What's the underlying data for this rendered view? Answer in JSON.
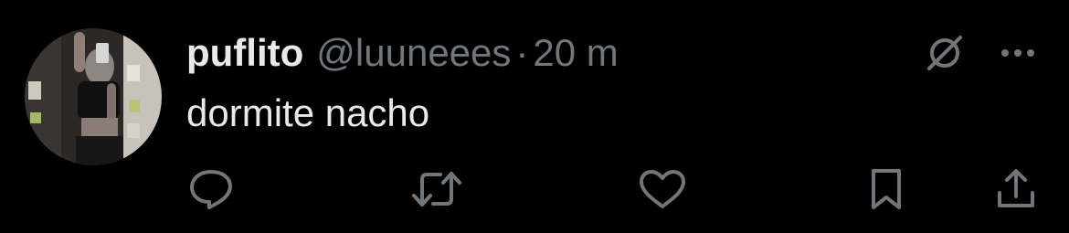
{
  "tweet": {
    "display_name": "puflito",
    "handle": "@luuneees",
    "separator": "·",
    "time": "20 m",
    "text": "dormite nacho"
  },
  "icons": {
    "top_right": [
      "grok-icon",
      "more-icon"
    ],
    "actions": [
      "reply-icon",
      "retweet-icon",
      "like-icon",
      "bookmark-icon",
      "share-icon"
    ]
  },
  "colors": {
    "background": "#000000",
    "primary_text": "#e7e9ea",
    "secondary_text": "#71767b"
  }
}
